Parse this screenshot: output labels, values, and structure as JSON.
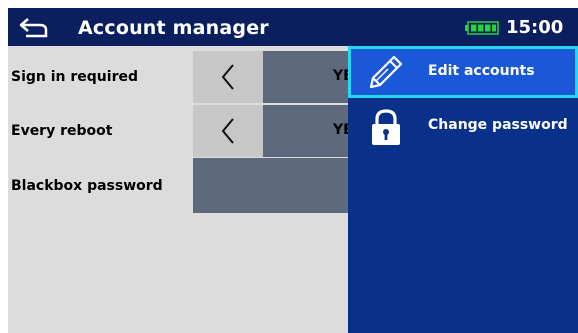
{
  "header": {
    "title": "Account manager",
    "time": "15:00",
    "back_icon": "back-arrow-icon",
    "battery_icon": "battery-full-icon",
    "battery_color": "#2bd13b"
  },
  "settings": [
    {
      "label": "Sign in required",
      "value": "YES",
      "icon": "chevron-left-icon"
    },
    {
      "label": "Every reboot",
      "value": "YES",
      "icon": "chevron-left-icon"
    },
    {
      "label": "Blackbox password",
      "value": ""
    }
  ],
  "menu": {
    "items": [
      {
        "label": "Edit accounts",
        "icon": "pencil-icon",
        "selected": true
      },
      {
        "label": "Change password",
        "icon": "lock-icon",
        "selected": false
      }
    ],
    "background": "#0a318a",
    "selected_background": "#1a58d8",
    "selected_outline": "#27d6f0"
  },
  "colors": {
    "header_bg": "#0b1f5e",
    "panel_bg": "#dcdcdc",
    "value_bg": "#5e6a7c"
  }
}
